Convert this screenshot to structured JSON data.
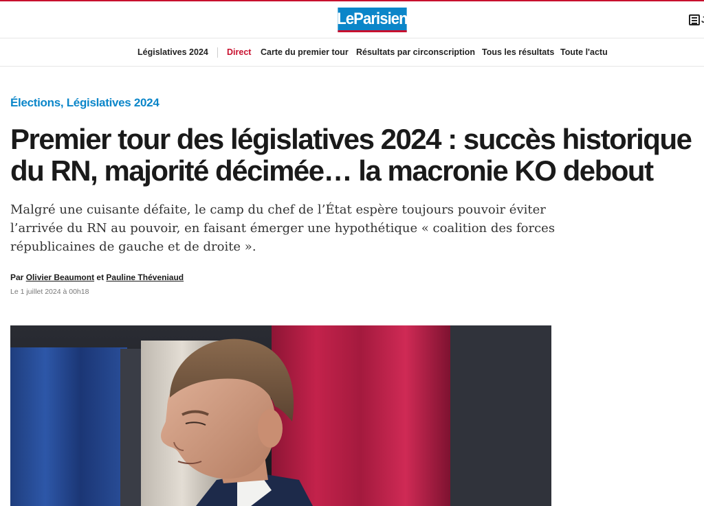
{
  "header": {
    "logo_text": "LeParisien",
    "edition_label": "J"
  },
  "nav": {
    "section": "Législatives 2024",
    "items": [
      {
        "label": "Direct"
      },
      {
        "label": "Carte du premier tour"
      },
      {
        "label": "Résultats par circonscription"
      },
      {
        "label": "Tous les résultats"
      },
      {
        "label": "Toute l'actu"
      }
    ]
  },
  "article": {
    "kicker": "Élections, Législatives 2024",
    "headline": "Premier tour des législatives 2024 : succès historique du RN, majorité décimée… la macronie KO debout",
    "lede": "Malgré une cuisante défaite, le camp du chef de l’État espère toujours pouvoir éviter l’arrivée du RN au pouvoir, en faisant émerger une hypothétique « coalition des forces républicaines de gauche et de droite ».",
    "byline_prefix": "Par",
    "author_1": "Olivier Beaumont",
    "byline_and": "et",
    "author_2": "Pauline Théveniaud",
    "date": "Le 1 juillet 2024 à 00h18"
  },
  "colors": {
    "brand_blue": "#0b86c9",
    "accent_red": "#c8102e"
  }
}
